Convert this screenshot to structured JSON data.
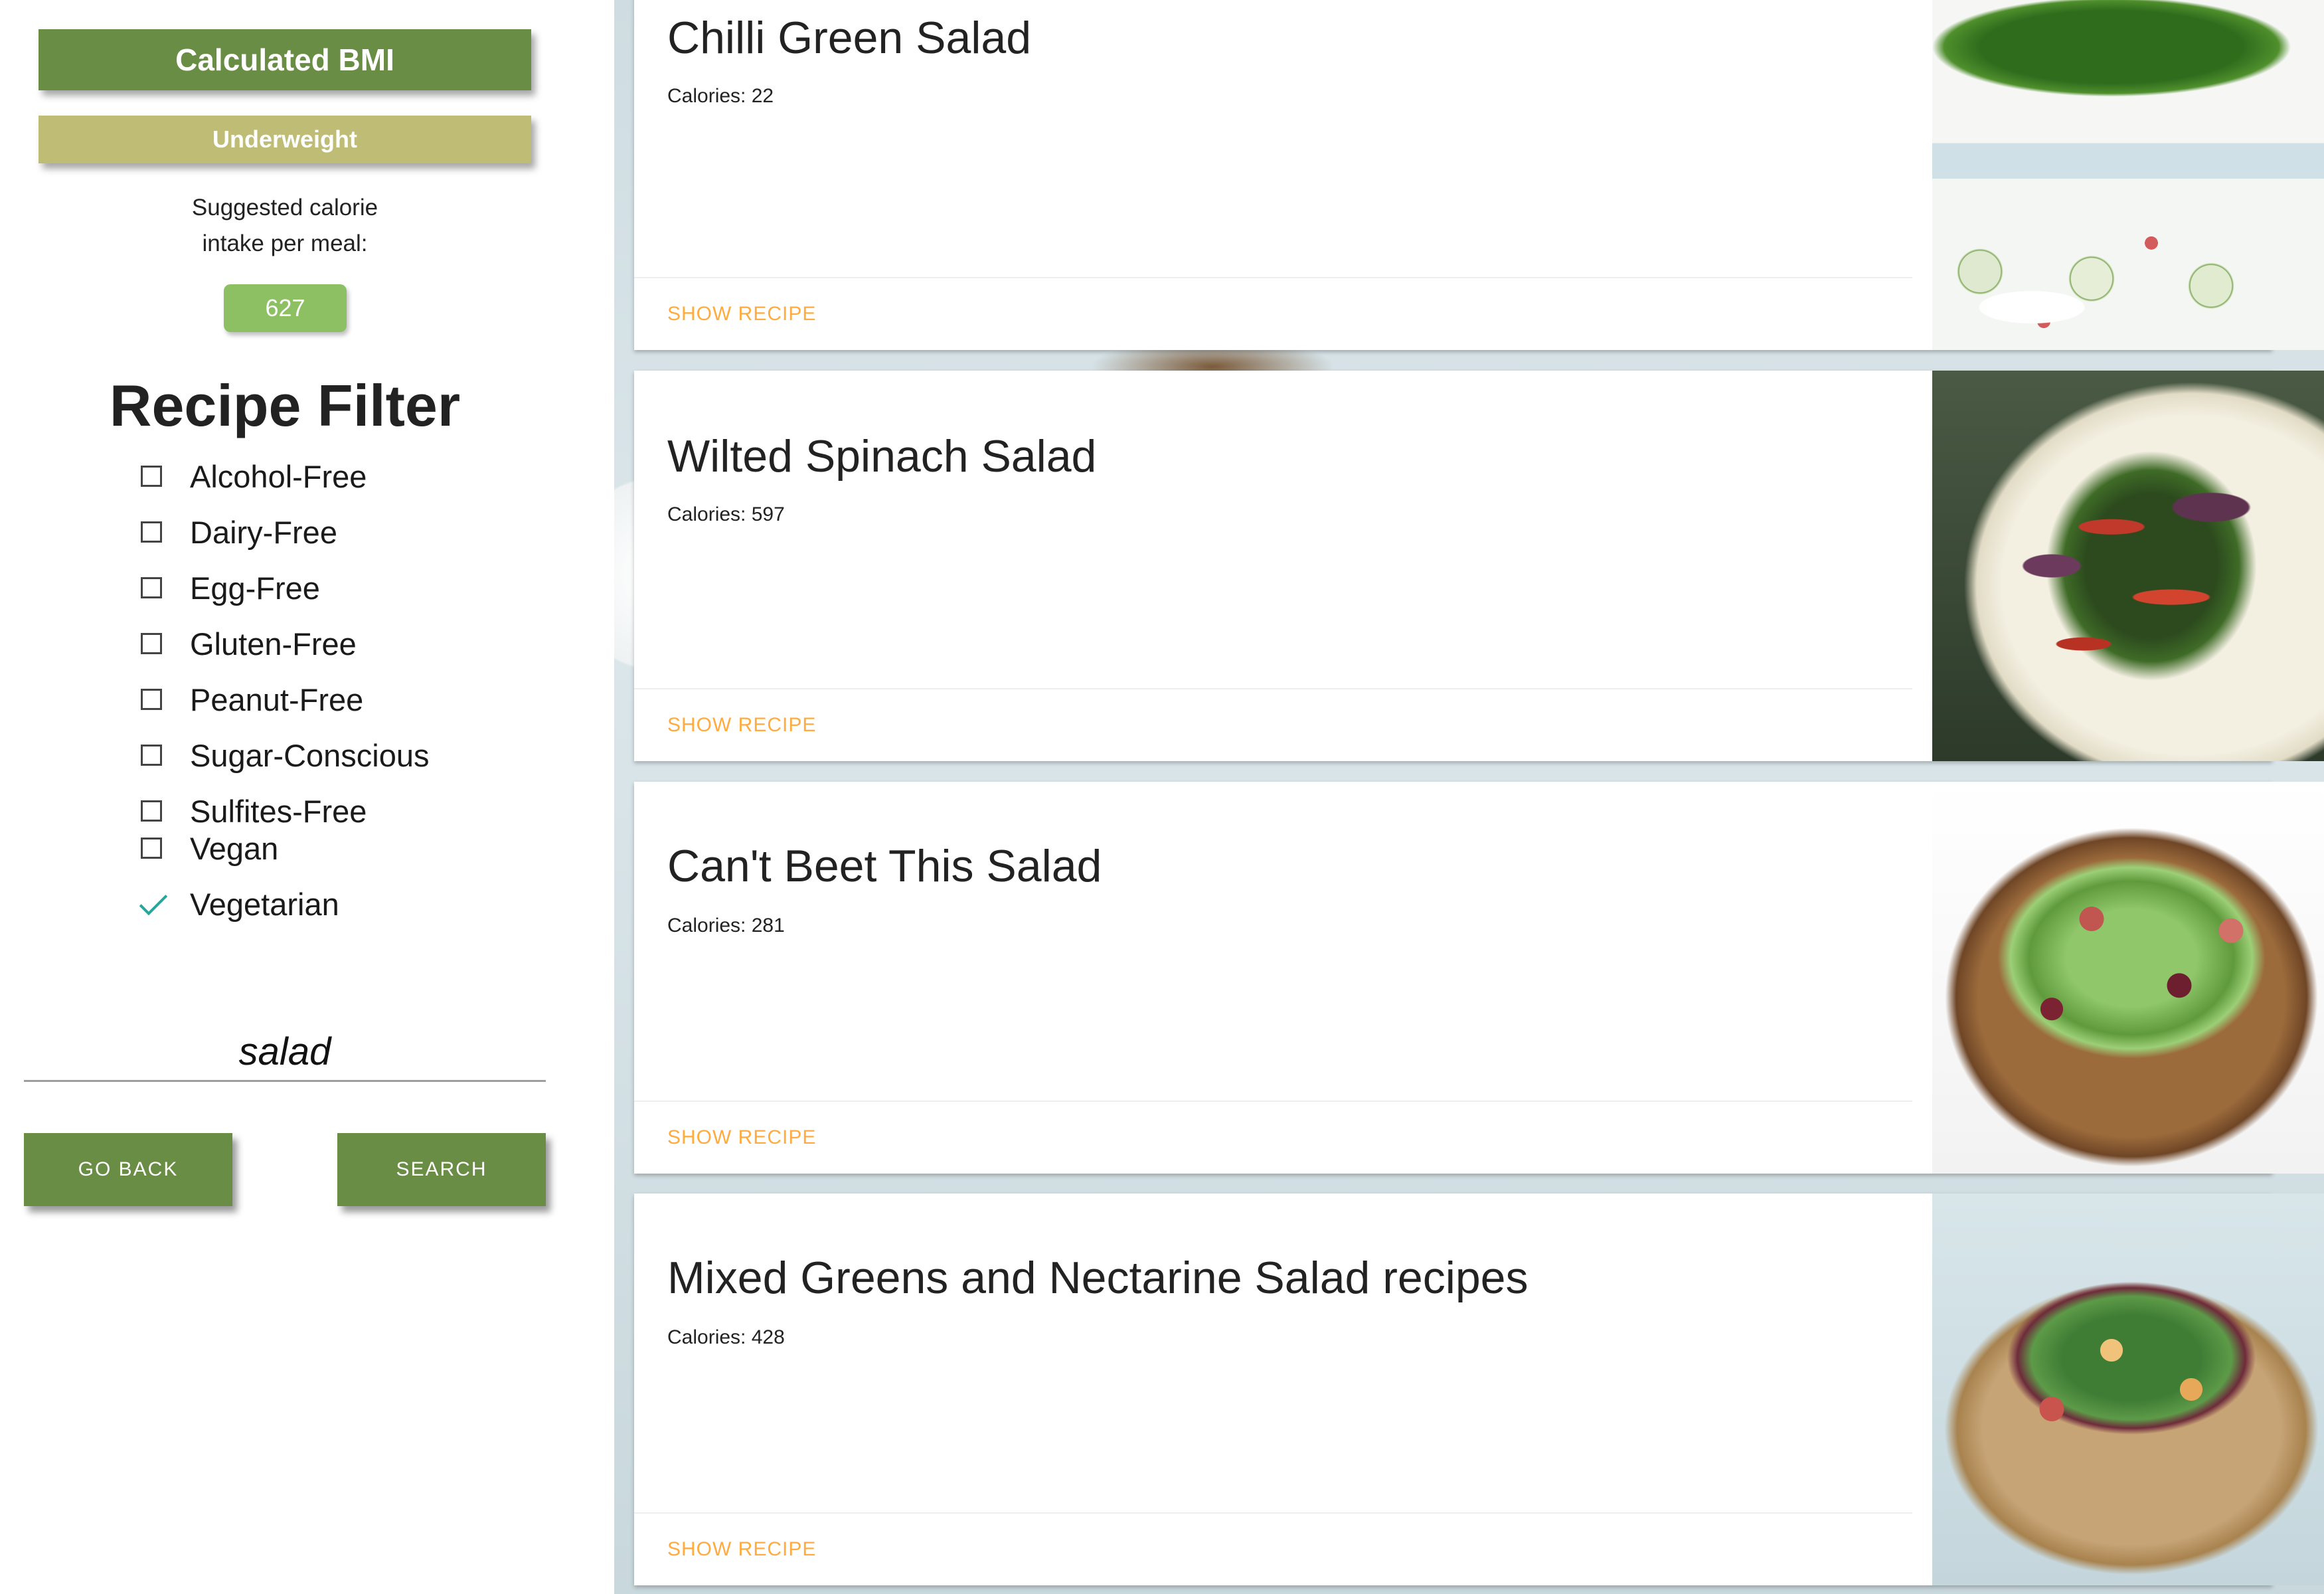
{
  "sidebar": {
    "bmi_title": "Calculated BMI",
    "bmi_status": "Underweight",
    "suggest_line1": "Suggested calorie",
    "suggest_line2": "intake per meal:",
    "calorie_value": "627",
    "filter_heading": "Recipe Filter",
    "filters": [
      {
        "label": "Alcohol-Free",
        "checked": false
      },
      {
        "label": "Dairy-Free",
        "checked": false
      },
      {
        "label": "Egg-Free",
        "checked": false
      },
      {
        "label": "Gluten-Free",
        "checked": false
      },
      {
        "label": "Peanut-Free",
        "checked": false
      },
      {
        "label": "Sugar-Conscious",
        "checked": false
      },
      {
        "label": "Sulfites-Free",
        "checked": false
      },
      {
        "label": "Vegan",
        "checked": false
      },
      {
        "label": "Vegetarian",
        "checked": true
      }
    ],
    "search_value": "salad",
    "go_back_label": "GO BACK",
    "search_label": "SEARCH"
  },
  "recipes": [
    {
      "title": "Chilli Green Salad",
      "calories": "Calories: 22",
      "action": "SHOW RECIPE",
      "image_icon": "salad-photo"
    },
    {
      "title": "Wilted Spinach Salad",
      "calories": "Calories: 597",
      "action": "SHOW RECIPE",
      "image_icon": "salad-photo"
    },
    {
      "title": "Can't Beet This Salad",
      "calories": "Calories: 281",
      "action": "SHOW RECIPE",
      "image_icon": "salad-photo"
    },
    {
      "title": "Mixed Greens and Nectarine Salad recipes",
      "calories": "Calories: 428",
      "action": "SHOW RECIPE",
      "image_icon": "salad-photo"
    }
  ],
  "colors": {
    "primary_green": "#6a8d45",
    "status_khaki": "#bfbc75",
    "calorie_pill": "#8cc063",
    "action_orange": "#ffab40",
    "checkmark_teal": "#26a69a"
  }
}
